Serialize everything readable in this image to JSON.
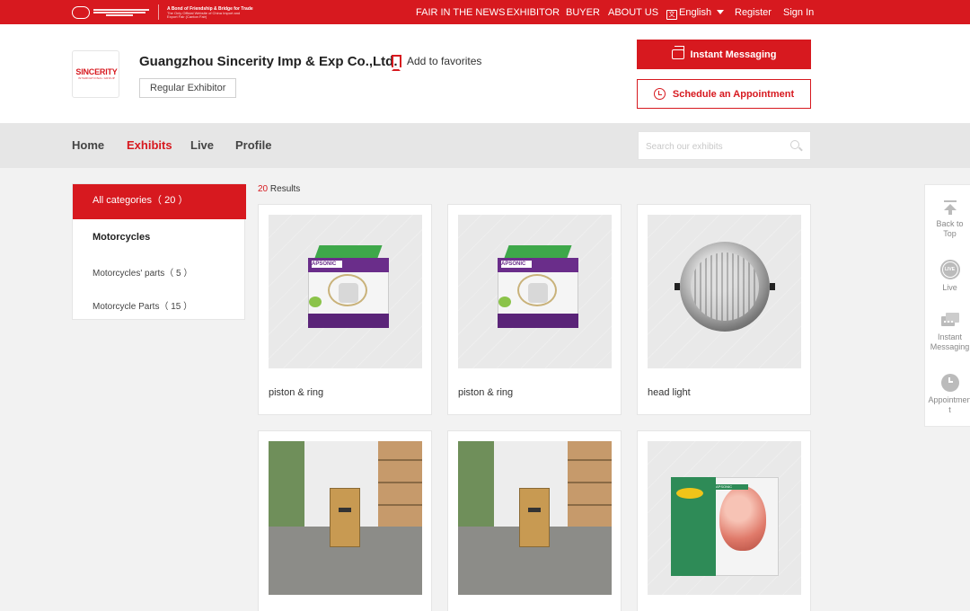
{
  "topbar": {
    "logo_tagline": "A Bond of Friendship & Bridge for Trade",
    "logo_subline": "The Only Official Website of China Import and Export Fair (Canton Fair)",
    "nav": [
      "FAIR IN THE NEWS",
      "EXHIBITOR",
      "BUYER",
      "ABOUT US"
    ],
    "language": "English",
    "register": "Register",
    "signin": "Sign In"
  },
  "company": {
    "logo_text": "SINCERITY",
    "logo_subtext": "INTERNATIONAL GROUP",
    "name": "Guangzhou Sincerity Imp & Exp Co.,Ltd.",
    "favorite_label": "Add to favorites",
    "badge": "Regular Exhibitor",
    "im_button": "Instant Messaging",
    "appointment_button": "Schedule an Appointment"
  },
  "tabs": [
    {
      "label": "Home",
      "active": false
    },
    {
      "label": "Exhibits",
      "active": true
    },
    {
      "label": "Live",
      "active": false
    },
    {
      "label": "Profile",
      "active": false
    }
  ],
  "search": {
    "placeholder": "Search our exhibits",
    "value": ""
  },
  "sidebar": {
    "all_label": "All categories（ 20 ）",
    "group": "Motorcycles",
    "items": [
      "Motorcycles' parts（ 5 ）",
      "Motorcycle Parts（ 15 ）"
    ]
  },
  "results": {
    "count": "20",
    "suffix": "Results",
    "products": [
      {
        "title": "piston & ring",
        "image": "piston-box"
      },
      {
        "title": "piston & ring",
        "image": "piston-box"
      },
      {
        "title": "head light",
        "image": "headlight"
      },
      {
        "title": "",
        "image": "carton-warehouse"
      },
      {
        "title": "",
        "image": "carton-warehouse"
      },
      {
        "title": "",
        "image": "lamp-box"
      }
    ]
  },
  "floatbar": {
    "items": [
      "Back to Top",
      "Live",
      "Instant Messaging",
      "Appointment"
    ]
  },
  "colors": {
    "brand_red": "#d7191f"
  }
}
